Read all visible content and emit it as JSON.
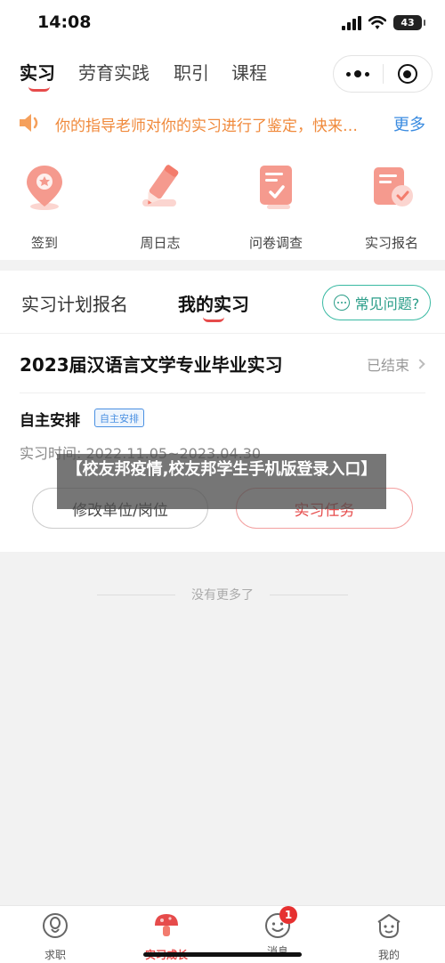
{
  "status_bar": {
    "time": "14:08",
    "battery": "43"
  },
  "top_nav": {
    "tabs": [
      {
        "label": "实习",
        "active": true
      },
      {
        "label": "劳育实践",
        "active": false
      },
      {
        "label": "职引",
        "active": false
      },
      {
        "label": "课程",
        "active": false
      }
    ],
    "capsule": {
      "more_icon": "more-dots-icon",
      "close_icon": "target-icon"
    }
  },
  "notice": {
    "text": "你的指导老师对你的实习进行了鉴定，快来…",
    "more": "更多",
    "icon": "speaker-icon"
  },
  "quick_actions": [
    {
      "label": "签到",
      "icon": "location-pin-icon"
    },
    {
      "label": "周日志",
      "icon": "pencil-icon"
    },
    {
      "label": "问卷调查",
      "icon": "survey-doc-icon"
    },
    {
      "label": "实习报名",
      "icon": "signup-doc-icon"
    }
  ],
  "sub_tabs": [
    {
      "label": "实习计划报名",
      "active": false
    },
    {
      "label": "我的实习",
      "active": true
    }
  ],
  "faq_button": "常见问题?",
  "internship": {
    "title": "2023届汉语言文学专业毕业实习",
    "status": "已结束",
    "arrangement": "自主安排",
    "arrangement_badge": "自主安排",
    "time_line": "实习时间: 2022.11.05~2023.04.30",
    "modify_button": "修改单位/岗位",
    "task_button": "实习任务"
  },
  "list_end": "没有更多了",
  "watermark": "【校友邦疫情,校友邦学生手机版登录入口】",
  "bottom_nav": [
    {
      "label": "求职",
      "icon": "job-icon",
      "active": false,
      "badge": ""
    },
    {
      "label": "实习成长",
      "icon": "mushroom-icon",
      "active": true,
      "badge": ""
    },
    {
      "label": "消息",
      "icon": "message-face-icon",
      "active": false,
      "badge": "1"
    },
    {
      "label": "我的",
      "icon": "profile-face-icon",
      "active": false,
      "badge": ""
    }
  ],
  "colors": {
    "accent_red": "#e64b4b",
    "notice_orange": "#f08a3c",
    "link_blue": "#3a8be0",
    "teal": "#38b9a2"
  }
}
